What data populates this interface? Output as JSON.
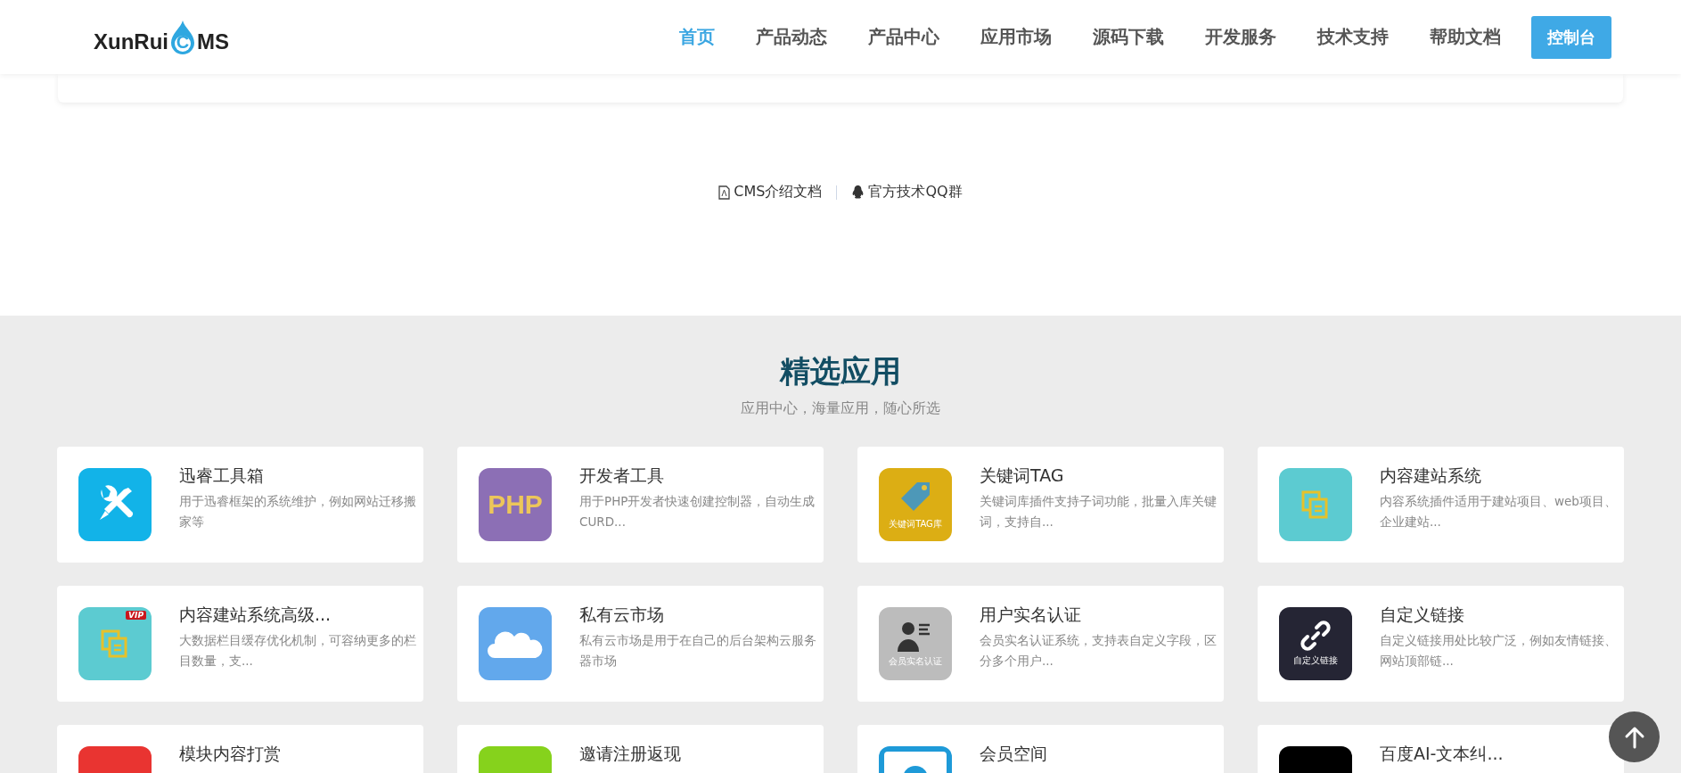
{
  "header": {
    "logo": {
      "text_before": "XunRui",
      "drop_letter": "C",
      "text_after": "MS"
    },
    "nav": [
      {
        "label": "首页",
        "selected": true
      },
      {
        "label": "产品动态",
        "selected": false
      },
      {
        "label": "产品中心",
        "selected": false
      },
      {
        "label": "应用市场",
        "selected": false
      },
      {
        "label": "源码下载",
        "selected": false
      },
      {
        "label": "开发服务",
        "selected": false
      },
      {
        "label": "技术支持",
        "selected": false
      },
      {
        "label": "帮助文档",
        "selected": false
      }
    ],
    "console_button": "控制台"
  },
  "links": [
    {
      "kind": "pdf",
      "label": "CMS介绍文档"
    },
    {
      "kind": "qq",
      "label": "官方技术QQ群"
    }
  ],
  "featured": {
    "title": "精选应用",
    "subtitle": "应用中心，海量应用，随心所选",
    "apps": [
      {
        "kind": "tools",
        "color": "#12b3e8",
        "title": "迅睿工具箱",
        "description": "用于迅睿框架的系统维护，例如网站迁移搬家等"
      },
      {
        "kind": "php",
        "color": "#8c6fb5",
        "icon_text": "PHP",
        "title": "开发者工具",
        "description": "用于PHP开发者快速创建控制器，自动生成CURD..."
      },
      {
        "kind": "tag",
        "color": "#dcae14",
        "icon_text": "关键词TAG库",
        "title": "关键词TAG",
        "description": "关键词库插件支持子词功能，批量入库关键词，支持自..."
      },
      {
        "kind": "pages",
        "color": "#5ccbd1",
        "title": "内容建站系统",
        "description": "内容系统插件适用于建站项目、web项目、企业建站..."
      },
      {
        "kind": "pages",
        "color": "#5ccbd1",
        "icon_text": "VIP",
        "title": "内容建站系统高级...",
        "description": "大数据栏目缓存优化机制，可容纳更多的栏目数量，支..."
      },
      {
        "kind": "cloud",
        "color": "#62a8ec",
        "title": "私有云市场",
        "description": "私有云市场是用于在自己的后台架构云服务器市场"
      },
      {
        "kind": "person",
        "color": "#bcbcbc",
        "icon_text": "会员实名认证",
        "title": "用户实名认证",
        "description": "会员实名认证系统，支持表自定义字段，区分多个用户..."
      },
      {
        "kind": "link",
        "color": "#252534",
        "icon_text": "自定义链接",
        "title": "自定义链接",
        "description": "自定义链接用处比较广泛，例如友情链接、网站顶部链..."
      },
      {
        "kind": "crown",
        "color": "#e93431",
        "title": "模块内容打赏"
      },
      {
        "kind": "plain",
        "color": "#86d21c",
        "title": "邀请注册返现"
      },
      {
        "kind": "monitor",
        "color": "#1e9ad8",
        "title": "会员空间"
      },
      {
        "kind": "plain",
        "color": "#000000",
        "title": "百度AI-文本纠..."
      }
    ]
  }
}
